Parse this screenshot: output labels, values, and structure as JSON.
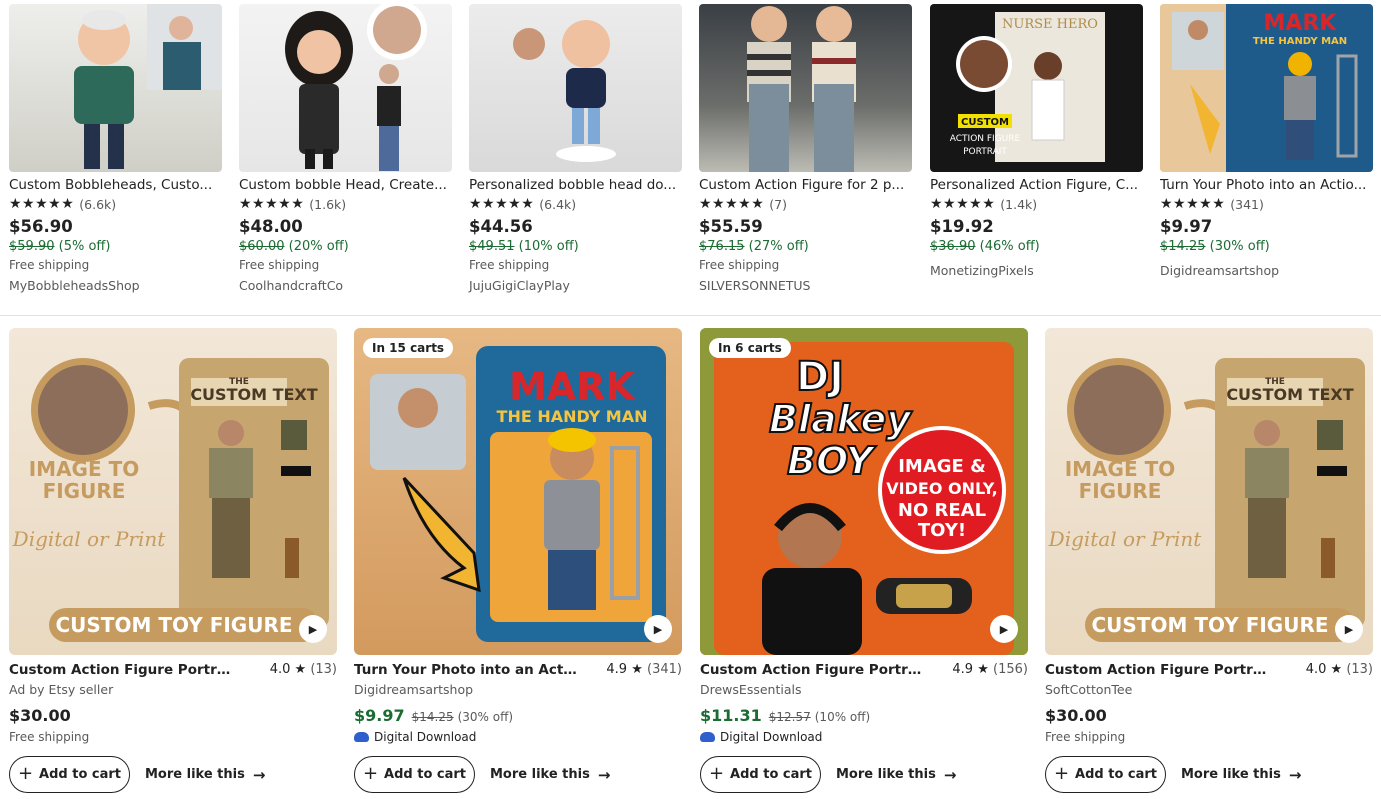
{
  "top_row": [
    {
      "title": "Custom Bobbleheads, Custo...",
      "stars": "★★★★★",
      "reviews": "(6.6k)",
      "price": "$56.90",
      "original_price": "$59.90",
      "discount": "(5% off)",
      "shipping": "Free shipping",
      "shop": "MyBobbleheadsShop"
    },
    {
      "title": "Custom bobble Head, Create...",
      "stars": "★★★★★",
      "reviews": "(1.6k)",
      "price": "$48.00",
      "original_price": "$60.00",
      "discount": "(20% off)",
      "shipping": "Free shipping",
      "shop": "CoolhandcraftCo"
    },
    {
      "title": "Personalized bobble head do...",
      "stars": "★★★★★",
      "reviews": "(6.4k)",
      "price": "$44.56",
      "original_price": "$49.51",
      "discount": "(10% off)",
      "shipping": "Free shipping",
      "shop": "JujuGigiClayPlay"
    },
    {
      "title": "Custom Action Figure for 2 p...",
      "stars": "★★★★★",
      "reviews": "(7)",
      "price": "$55.59",
      "original_price": "$76.15",
      "discount": "(27% off)",
      "shipping": "Free shipping",
      "shop": "SILVERSONNETUS"
    },
    {
      "title": "Personalized Action Figure, C...",
      "stars": "★★★★★",
      "reviews": "(1.4k)",
      "price": "$19.92",
      "original_price": "$36.90",
      "discount": "(46% off)",
      "shipping": "",
      "shop": "MonetizingPixels"
    },
    {
      "title": "Turn Your Photo into an Actio...",
      "stars": "★★★★★",
      "reviews": "(341)",
      "price": "$9.97",
      "original_price": "$14.25",
      "discount": "(30% off)",
      "shipping": "",
      "shop": "Digidreamsartshop"
    }
  ],
  "bottom_row": [
    {
      "badge": "",
      "title": "Custom Action Figure Portrait | P...",
      "rating": "4.0",
      "reviews": "(13)",
      "seller": "Ad by Etsy seller",
      "price": "$30.00",
      "original_price": "",
      "discount": "",
      "sub": "Free shipping",
      "add_to_cart": "Add to cart",
      "more_like": "More like this"
    },
    {
      "badge": "In 15 carts",
      "title": "Turn Your Photo into an Action Fi...",
      "rating": "4.9",
      "reviews": "(341)",
      "seller": "Digidreamsartshop",
      "price": "$9.97",
      "original_price": "$14.25",
      "discount": "(30% off)",
      "sub": "Digital Download",
      "add_to_cart": "Add to cart",
      "more_like": "More like this"
    },
    {
      "badge": "In 6 carts",
      "title": "Custom Action Figure Portrait In...",
      "rating": "4.9",
      "reviews": "(156)",
      "seller": "DrewsEssentials",
      "price": "$11.31",
      "original_price": "$12.57",
      "discount": "(10% off)",
      "sub": "Digital Download",
      "add_to_cart": "Add to cart",
      "more_like": "More like this"
    },
    {
      "badge": "",
      "title": "Custom Action Figure Portrait | P...",
      "rating": "4.0",
      "reviews": "(13)",
      "seller": "SoftCottonTee",
      "price": "$30.00",
      "original_price": "",
      "discount": "",
      "sub": "Free shipping",
      "add_to_cart": "Add to cart",
      "more_like": "More like this"
    }
  ],
  "image_text": {
    "mark": "MARK",
    "handy_man": "THE HANDY MAN",
    "the": "THE",
    "custom_text": "CUSTOM TEXT",
    "image_to": "IMAGE TO",
    "figure": "FIGURE",
    "digital_or_print": "Digital or Print",
    "custom_toy_figure": "CUSTOM TOY FIGURE",
    "dj": "DJ",
    "blakey": "Blakey",
    "boy": "BOY",
    "image_video": "IMAGE &",
    "video_only": "VIDEO ONLY,",
    "no_real": "NO REAL",
    "toy": "TOY!",
    "nurse_hero": "NURSE HERO",
    "custom": "CUSTOM",
    "action_figure": "ACTION FIGURE",
    "portrait": "PORTRAIT"
  },
  "colors": {
    "green_price": "#1b6b33",
    "muted": "#595959",
    "dl_icon": "#2f5fcc"
  }
}
